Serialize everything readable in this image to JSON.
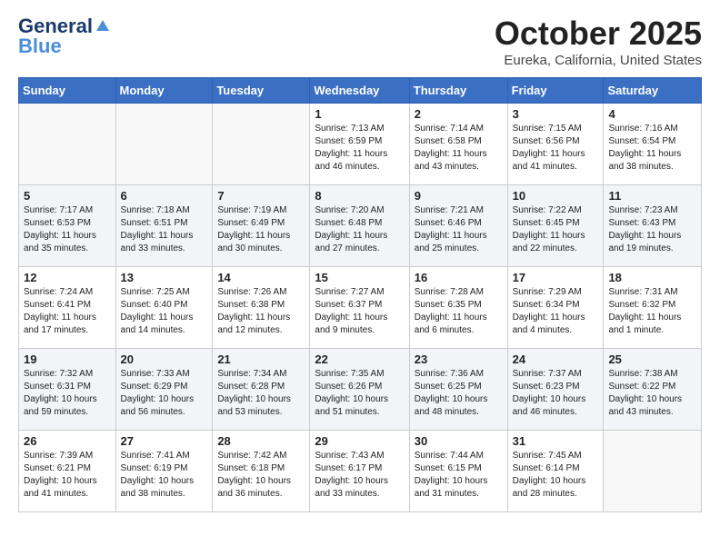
{
  "header": {
    "logo_line1": "General",
    "logo_line2": "Blue",
    "title": "October 2025",
    "subtitle": "Eureka, California, United States"
  },
  "days_of_week": [
    "Sunday",
    "Monday",
    "Tuesday",
    "Wednesday",
    "Thursday",
    "Friday",
    "Saturday"
  ],
  "weeks": [
    [
      {
        "day": "",
        "info": ""
      },
      {
        "day": "",
        "info": ""
      },
      {
        "day": "",
        "info": ""
      },
      {
        "day": "1",
        "info": "Sunrise: 7:13 AM\nSunset: 6:59 PM\nDaylight: 11 hours and 46 minutes."
      },
      {
        "day": "2",
        "info": "Sunrise: 7:14 AM\nSunset: 6:58 PM\nDaylight: 11 hours and 43 minutes."
      },
      {
        "day": "3",
        "info": "Sunrise: 7:15 AM\nSunset: 6:56 PM\nDaylight: 11 hours and 41 minutes."
      },
      {
        "day": "4",
        "info": "Sunrise: 7:16 AM\nSunset: 6:54 PM\nDaylight: 11 hours and 38 minutes."
      }
    ],
    [
      {
        "day": "5",
        "info": "Sunrise: 7:17 AM\nSunset: 6:53 PM\nDaylight: 11 hours and 35 minutes."
      },
      {
        "day": "6",
        "info": "Sunrise: 7:18 AM\nSunset: 6:51 PM\nDaylight: 11 hours and 33 minutes."
      },
      {
        "day": "7",
        "info": "Sunrise: 7:19 AM\nSunset: 6:49 PM\nDaylight: 11 hours and 30 minutes."
      },
      {
        "day": "8",
        "info": "Sunrise: 7:20 AM\nSunset: 6:48 PM\nDaylight: 11 hours and 27 minutes."
      },
      {
        "day": "9",
        "info": "Sunrise: 7:21 AM\nSunset: 6:46 PM\nDaylight: 11 hours and 25 minutes."
      },
      {
        "day": "10",
        "info": "Sunrise: 7:22 AM\nSunset: 6:45 PM\nDaylight: 11 hours and 22 minutes."
      },
      {
        "day": "11",
        "info": "Sunrise: 7:23 AM\nSunset: 6:43 PM\nDaylight: 11 hours and 19 minutes."
      }
    ],
    [
      {
        "day": "12",
        "info": "Sunrise: 7:24 AM\nSunset: 6:41 PM\nDaylight: 11 hours and 17 minutes."
      },
      {
        "day": "13",
        "info": "Sunrise: 7:25 AM\nSunset: 6:40 PM\nDaylight: 11 hours and 14 minutes."
      },
      {
        "day": "14",
        "info": "Sunrise: 7:26 AM\nSunset: 6:38 PM\nDaylight: 11 hours and 12 minutes."
      },
      {
        "day": "15",
        "info": "Sunrise: 7:27 AM\nSunset: 6:37 PM\nDaylight: 11 hours and 9 minutes."
      },
      {
        "day": "16",
        "info": "Sunrise: 7:28 AM\nSunset: 6:35 PM\nDaylight: 11 hours and 6 minutes."
      },
      {
        "day": "17",
        "info": "Sunrise: 7:29 AM\nSunset: 6:34 PM\nDaylight: 11 hours and 4 minutes."
      },
      {
        "day": "18",
        "info": "Sunrise: 7:31 AM\nSunset: 6:32 PM\nDaylight: 11 hours and 1 minute."
      }
    ],
    [
      {
        "day": "19",
        "info": "Sunrise: 7:32 AM\nSunset: 6:31 PM\nDaylight: 10 hours and 59 minutes."
      },
      {
        "day": "20",
        "info": "Sunrise: 7:33 AM\nSunset: 6:29 PM\nDaylight: 10 hours and 56 minutes."
      },
      {
        "day": "21",
        "info": "Sunrise: 7:34 AM\nSunset: 6:28 PM\nDaylight: 10 hours and 53 minutes."
      },
      {
        "day": "22",
        "info": "Sunrise: 7:35 AM\nSunset: 6:26 PM\nDaylight: 10 hours and 51 minutes."
      },
      {
        "day": "23",
        "info": "Sunrise: 7:36 AM\nSunset: 6:25 PM\nDaylight: 10 hours and 48 minutes."
      },
      {
        "day": "24",
        "info": "Sunrise: 7:37 AM\nSunset: 6:23 PM\nDaylight: 10 hours and 46 minutes."
      },
      {
        "day": "25",
        "info": "Sunrise: 7:38 AM\nSunset: 6:22 PM\nDaylight: 10 hours and 43 minutes."
      }
    ],
    [
      {
        "day": "26",
        "info": "Sunrise: 7:39 AM\nSunset: 6:21 PM\nDaylight: 10 hours and 41 minutes."
      },
      {
        "day": "27",
        "info": "Sunrise: 7:41 AM\nSunset: 6:19 PM\nDaylight: 10 hours and 38 minutes."
      },
      {
        "day": "28",
        "info": "Sunrise: 7:42 AM\nSunset: 6:18 PM\nDaylight: 10 hours and 36 minutes."
      },
      {
        "day": "29",
        "info": "Sunrise: 7:43 AM\nSunset: 6:17 PM\nDaylight: 10 hours and 33 minutes."
      },
      {
        "day": "30",
        "info": "Sunrise: 7:44 AM\nSunset: 6:15 PM\nDaylight: 10 hours and 31 minutes."
      },
      {
        "day": "31",
        "info": "Sunrise: 7:45 AM\nSunset: 6:14 PM\nDaylight: 10 hours and 28 minutes."
      },
      {
        "day": "",
        "info": ""
      }
    ]
  ]
}
